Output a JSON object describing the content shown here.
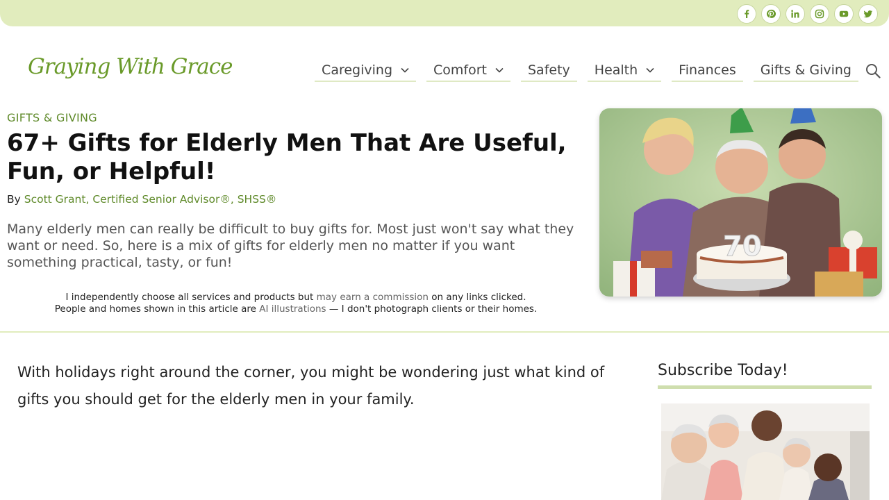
{
  "site": {
    "logo_text": "Graying With Grace"
  },
  "socials": [
    {
      "name": "facebook-icon",
      "glyph": "f"
    },
    {
      "name": "pinterest-icon",
      "glyph": "p"
    },
    {
      "name": "linkedin-icon",
      "glyph": "in"
    },
    {
      "name": "instagram-icon",
      "glyph": "ig"
    },
    {
      "name": "youtube-icon",
      "glyph": "yt"
    },
    {
      "name": "twitter-icon",
      "glyph": "tw"
    }
  ],
  "nav": {
    "items": [
      {
        "label": "Caregiving",
        "dropdown": true
      },
      {
        "label": "Comfort",
        "dropdown": true
      },
      {
        "label": "Safety",
        "dropdown": false
      },
      {
        "label": "Health",
        "dropdown": true
      },
      {
        "label": "Finances",
        "dropdown": false
      },
      {
        "label": "Gifts & Giving",
        "dropdown": false
      }
    ]
  },
  "article": {
    "category": "GIFTS & GIVING",
    "title": "67+ Gifts for Elderly Men That Are Useful, Fun, or Helpful!",
    "by_prefix": "By",
    "author": "Scott Grant, Certified Senior Advisor®, SHSS®",
    "excerpt": "Many elderly men can really be difficult to buy gifts for. Most just won't say what they want or need. So, here is a mix of gifts for elderly men no matter if you want something practical, tasty, or fun!",
    "disclosure_1a": "I independently choose all services and products but",
    "disclosure_1_link": "may earn a commission",
    "disclosure_1b": "on any links clicked.",
    "disclosure_2a": "People and homes shown in this article are",
    "disclosure_2_link": "AI illustrations",
    "disclosure_2b": "— I don't photograph clients or their homes.",
    "body": "With holidays right around the corner, you might be wondering just what kind of gifts you should get for the elderly men in your family."
  },
  "sidebar": {
    "subscribe_title": "Subscribe Today!"
  },
  "colors": {
    "accent": "#5f8a2a",
    "topbar": "#e1ecbd",
    "underline": "#dfe9c4"
  }
}
